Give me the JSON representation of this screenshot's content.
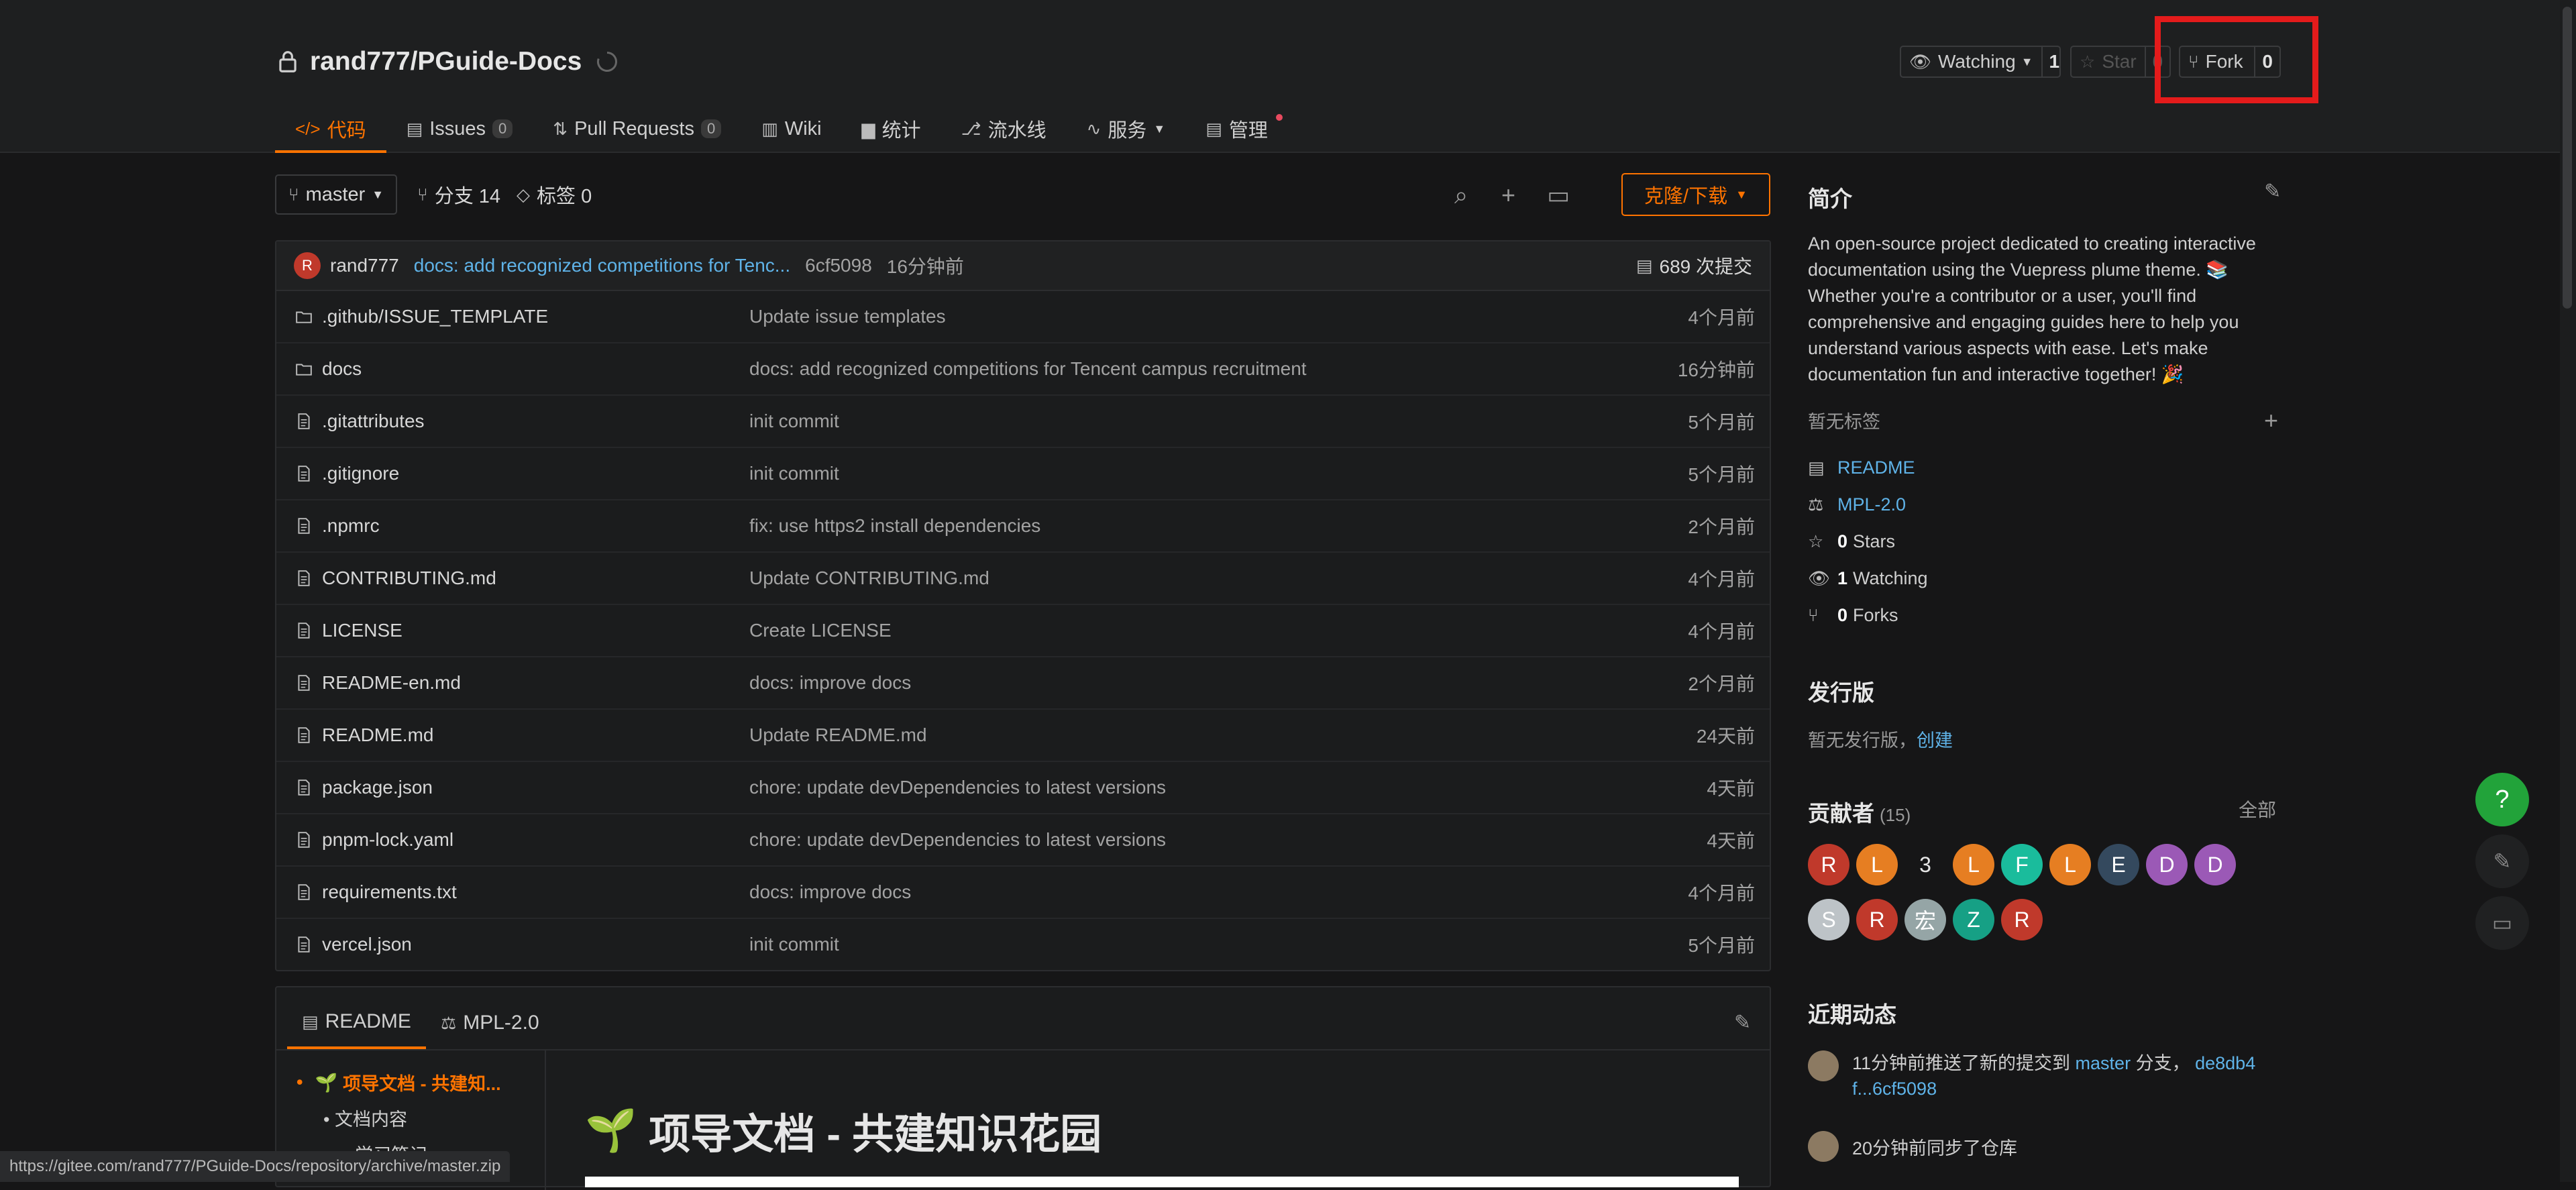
{
  "repo": {
    "path": "rand777/PGuide-Docs"
  },
  "actions": {
    "watch": {
      "label": "Watching",
      "count": "1"
    },
    "star": {
      "label": "Star",
      "count": "0"
    },
    "fork": {
      "label": "Fork",
      "count": "0"
    }
  },
  "tabs": [
    {
      "label": "代码"
    },
    {
      "label": "Issues",
      "badge": "0"
    },
    {
      "label": "Pull Requests",
      "badge": "0"
    },
    {
      "label": "Wiki"
    },
    {
      "label": "统计"
    },
    {
      "label": "流水线"
    },
    {
      "label": "服务"
    },
    {
      "label": "管理"
    }
  ],
  "branch": {
    "current": "master",
    "branches": "分支 14",
    "tags": "标签 0"
  },
  "clone_label": "克隆/下载",
  "commit": {
    "author_initial": "R",
    "author": "rand777",
    "message": "docs: add recognized competitions for Tenc...",
    "hash": "6cf5098",
    "time": "16分钟前",
    "total": "689 次提交"
  },
  "files": [
    {
      "name": ".github/ISSUE_TEMPLATE",
      "type": "folder",
      "msg": "Update issue templates",
      "date": "4个月前"
    },
    {
      "name": "docs",
      "type": "folder",
      "msg": "docs: add recognized competitions for Tencent campus recruitment",
      "date": "16分钟前"
    },
    {
      "name": ".gitattributes",
      "type": "file",
      "msg": "init commit",
      "date": "5个月前"
    },
    {
      "name": ".gitignore",
      "type": "file",
      "msg": "init commit",
      "date": "5个月前"
    },
    {
      "name": ".npmrc",
      "type": "file",
      "msg": "fix: use https2 install dependencies",
      "date": "2个月前"
    },
    {
      "name": "CONTRIBUTING.md",
      "type": "file",
      "msg": "Update CONTRIBUTING.md",
      "date": "4个月前"
    },
    {
      "name": "LICENSE",
      "type": "file",
      "msg": "Create LICENSE",
      "date": "4个月前"
    },
    {
      "name": "README-en.md",
      "type": "file",
      "msg": "docs: improve docs",
      "date": "2个月前"
    },
    {
      "name": "README.md",
      "type": "file",
      "msg": "Update README.md",
      "date": "24天前"
    },
    {
      "name": "package.json",
      "type": "file",
      "msg": "chore: update devDependencies to latest versions",
      "date": "4天前"
    },
    {
      "name": "pnpm-lock.yaml",
      "type": "file",
      "msg": "chore: update devDependencies to latest versions",
      "date": "4天前"
    },
    {
      "name": "requirements.txt",
      "type": "file",
      "msg": "docs: improve docs",
      "date": "4个月前"
    },
    {
      "name": "vercel.json",
      "type": "file",
      "msg": "init commit",
      "date": "5个月前"
    }
  ],
  "readme": {
    "tab_readme": "README",
    "tab_license": "MPL-2.0",
    "toc": [
      "项导文档 - 共建知...",
      "文档内容",
      "学习笔记"
    ],
    "heading": "项导文档 - 共建知识花园"
  },
  "sidebar": {
    "intro_title": "简介",
    "intro_text": "An open-source project dedicated to creating interactive documentation using the Vuepress plume theme. 📚 Whether you're a contributor or a user, you'll find comprehensive and engaging guides here to help you understand various aspects with ease. Let's make documentation fun and interactive together! 🎉",
    "no_tags": "暂无标签",
    "readme_link": "README",
    "license_link": "MPL-2.0",
    "stars_count": "0",
    "stars_label": "Stars",
    "watching_count": "1",
    "watching_label": "Watching",
    "forks_count": "0",
    "forks_label": "Forks",
    "release_title": "发行版",
    "release_text": "暂无发行版，",
    "release_create": "创建",
    "contrib_title": "贡献者",
    "contrib_count": "(15)",
    "contrib_all": "全部",
    "contributors": [
      {
        "i": "R",
        "c": "#c0392b"
      },
      {
        "i": "L",
        "c": "#e67e22"
      },
      {
        "i": "3",
        "c": "none"
      },
      {
        "i": "L",
        "c": "#e67e22"
      },
      {
        "i": "F",
        "c": "#1abc9c"
      },
      {
        "i": "L",
        "c": "#e67e22"
      },
      {
        "i": "E",
        "c": "#34495e"
      },
      {
        "i": "D",
        "c": "#9b59b6"
      },
      {
        "i": "D",
        "c": "#9b59b6"
      },
      {
        "i": "S",
        "c": "#bdc3c7"
      },
      {
        "i": "R",
        "c": "#c0392b"
      },
      {
        "i": "宏",
        "c": "#95a5a6"
      },
      {
        "i": "Z",
        "c": "#16a085"
      },
      {
        "i": "R",
        "c": "#c0392b"
      }
    ],
    "activity_title": "近期动态",
    "activity_1_pre": "11分钟前推送了新的提交到",
    "activity_1_branch": "master",
    "activity_1_mid": "分支，",
    "activity_1_hash": "de8db4f...6cf5098",
    "activity_2": "20分钟前同步了仓库"
  },
  "status_url": "https://gitee.com/rand777/PGuide-Docs/repository/archive/master.zip",
  "colors": {
    "accent": "#fe7300",
    "link": "#5fb3e8",
    "highlight_box": "#e41b1b"
  }
}
